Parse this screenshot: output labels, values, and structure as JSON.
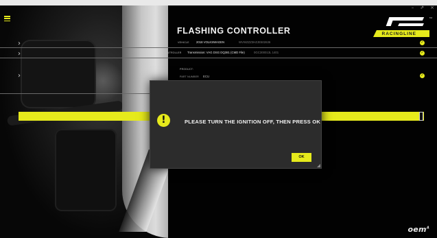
{
  "window": {
    "controls": {
      "minimize": "–",
      "restore": "⇗",
      "close": "×"
    }
  },
  "header": {
    "title": "FLASHING CONTROLLER",
    "brand": "RACINGLINE",
    "trademark": "TM"
  },
  "vehicle": {
    "label": "VEHICLE",
    "value": "2018 VOLKSWAGEN",
    "vin": "WVWZZZ3HZJE502636"
  },
  "controller": {
    "label": "CONTROLLER",
    "value": "Transmission: VAG DSG DQ381 (CMD File)",
    "part": "0GC300013L 1401"
  },
  "product": {
    "label": "PRODUCT:",
    "part_label": "PART NUMBER",
    "part_value": "ECU"
  },
  "progress": {
    "fraction": 0.99
  },
  "dialog": {
    "icon": "warning-icon",
    "message": "PLEASE TURN THE IGNITION OFF, THEN PRESS OK",
    "ok_label": "OK"
  },
  "footer": {
    "logo": "oem",
    "superscript": "A"
  },
  "colors": {
    "accent": "#e6ea1c",
    "dialog_bg": "#2c2c2c",
    "background": "#020202"
  },
  "icons": [
    "menu-icon",
    "chevron-right-icon",
    "check-circle-icon",
    "warning-icon"
  ]
}
